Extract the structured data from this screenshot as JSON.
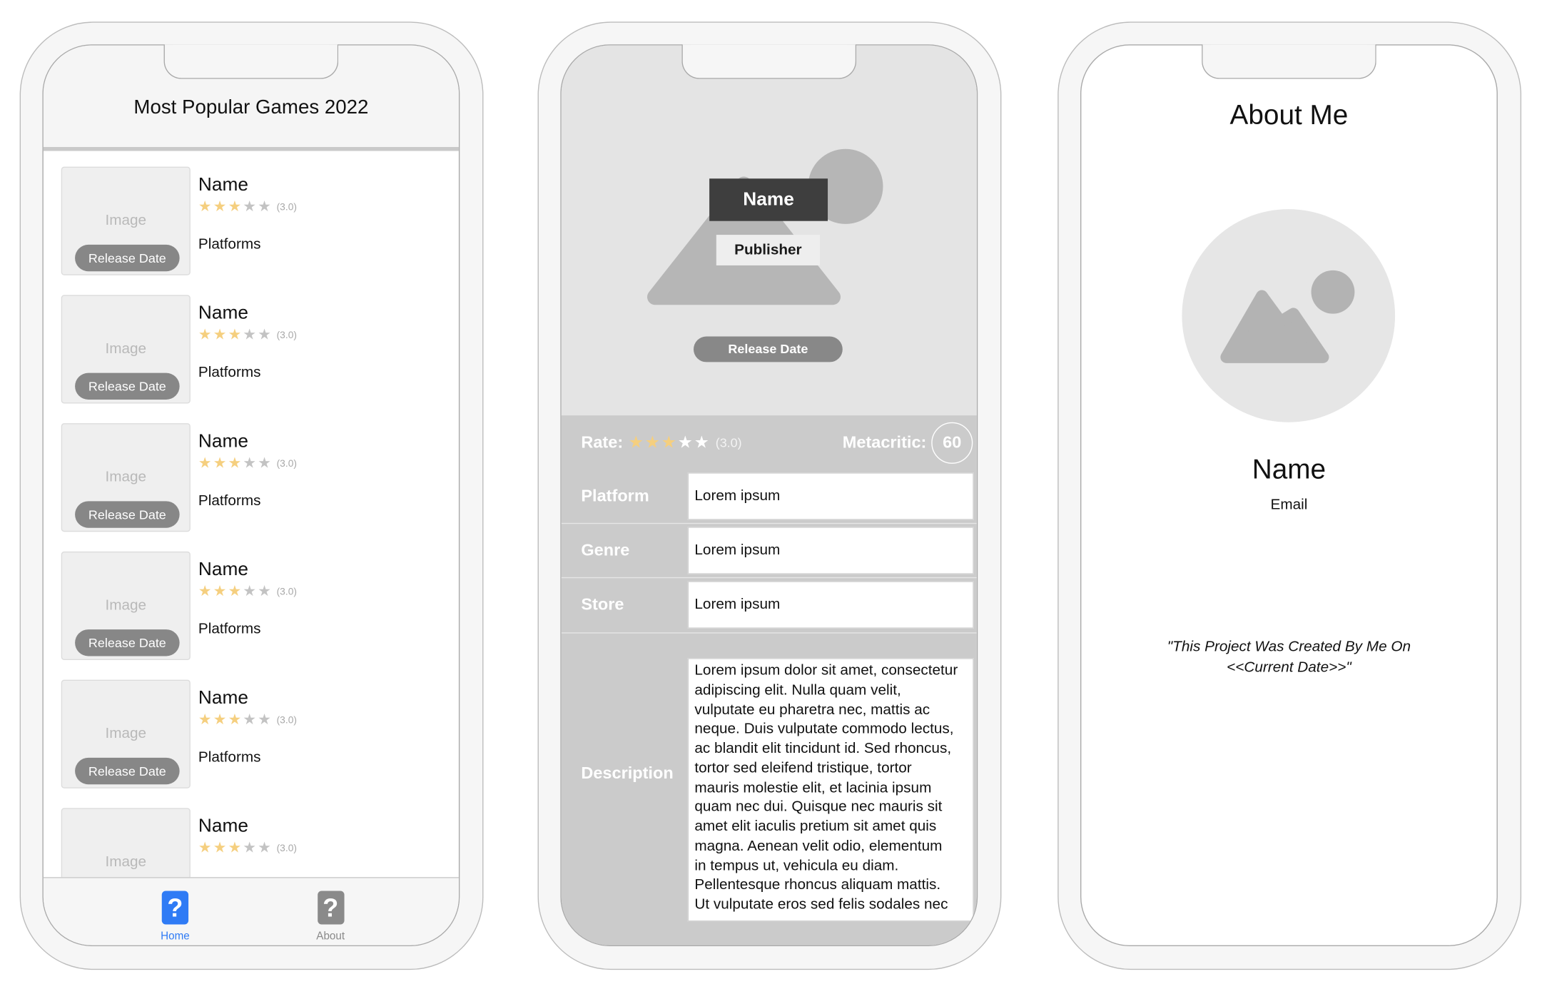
{
  "list_screen": {
    "title": "Most Popular Games 2022",
    "items": [
      {
        "image_label": "Image",
        "release_date": "Release Date",
        "name": "Name",
        "rating": 3,
        "rating_max": 5,
        "rating_text": "(3.0)",
        "platforms": "Platforms"
      },
      {
        "image_label": "Image",
        "release_date": "Release Date",
        "name": "Name",
        "rating": 3,
        "rating_max": 5,
        "rating_text": "(3.0)",
        "platforms": "Platforms"
      },
      {
        "image_label": "Image",
        "release_date": "Release Date",
        "name": "Name",
        "rating": 3,
        "rating_max": 5,
        "rating_text": "(3.0)",
        "platforms": "Platforms"
      },
      {
        "image_label": "Image",
        "release_date": "Release Date",
        "name": "Name",
        "rating": 3,
        "rating_max": 5,
        "rating_text": "(3.0)",
        "platforms": "Platforms"
      },
      {
        "image_label": "Image",
        "release_date": "Release Date",
        "name": "Name",
        "rating": 3,
        "rating_max": 5,
        "rating_text": "(3.0)",
        "platforms": "Platforms"
      },
      {
        "image_label": "Image",
        "name": "Name",
        "rating": 3,
        "rating_max": 5,
        "rating_text": "(3.0)"
      }
    ],
    "tabs": [
      {
        "label": "Home",
        "icon": "question-mark-icon",
        "icon_glyph": "?",
        "active": true
      },
      {
        "label": "About",
        "icon": "question-mark-icon",
        "icon_glyph": "?",
        "active": false
      }
    ]
  },
  "detail_screen": {
    "name": "Name",
    "publisher": "Publisher",
    "release_date": "Release Date",
    "rate_label": "Rate:",
    "rating": 3,
    "rating_max": 5,
    "rating_text": "(3.0)",
    "metacritic_label": "Metacritic:",
    "metacritic_score": "60",
    "fields": [
      {
        "label": "Platform",
        "value": "Lorem ipsum"
      },
      {
        "label": "Genre",
        "value": "Lorem ipsum"
      },
      {
        "label": "Store",
        "value": "Lorem ipsum"
      }
    ],
    "description_label": "Description",
    "description": "Lorem ipsum dolor sit amet, consectetur\nadipiscing elit. Nulla quam velit,\nvulputate eu pharetra nec, mattis ac\nneque. Duis vulputate commodo lectus,\nac blandit elit tincidunt id. Sed rhoncus,\ntortor sed eleifend tristique, tortor\nmauris molestie elit, et lacinia ipsum\nquam nec dui. Quisque nec mauris sit\namet elit iaculis pretium sit amet quis\nmagna. Aenean velit odio, elementum\nin tempus ut, vehicula eu diam.\nPellentesque rhoncus aliquam mattis.\nUt vulputate eros sed felis sodales nec"
  },
  "about_screen": {
    "title": "About Me",
    "name": "Name",
    "email": "Email",
    "quote_lines": [
      "\"This Project Was Created By Me On",
      "<<Current Date>>\""
    ]
  },
  "icons": {
    "rating": "star-icon",
    "star_glyph": "★",
    "placeholder": "image-placeholder-icon"
  },
  "colors": {
    "tab_active": "#2f7bf5",
    "tab_inactive": "#8a8a8a",
    "star_filled": "#f5cf7f",
    "star_empty_list": "#c3c3c3",
    "star_empty_detail": "#ffffff",
    "badge": "#878787",
    "name_box": "#3e3e3e",
    "details_panel": "#cbcbcb",
    "placeholder_shape": "#b6b6b6"
  }
}
